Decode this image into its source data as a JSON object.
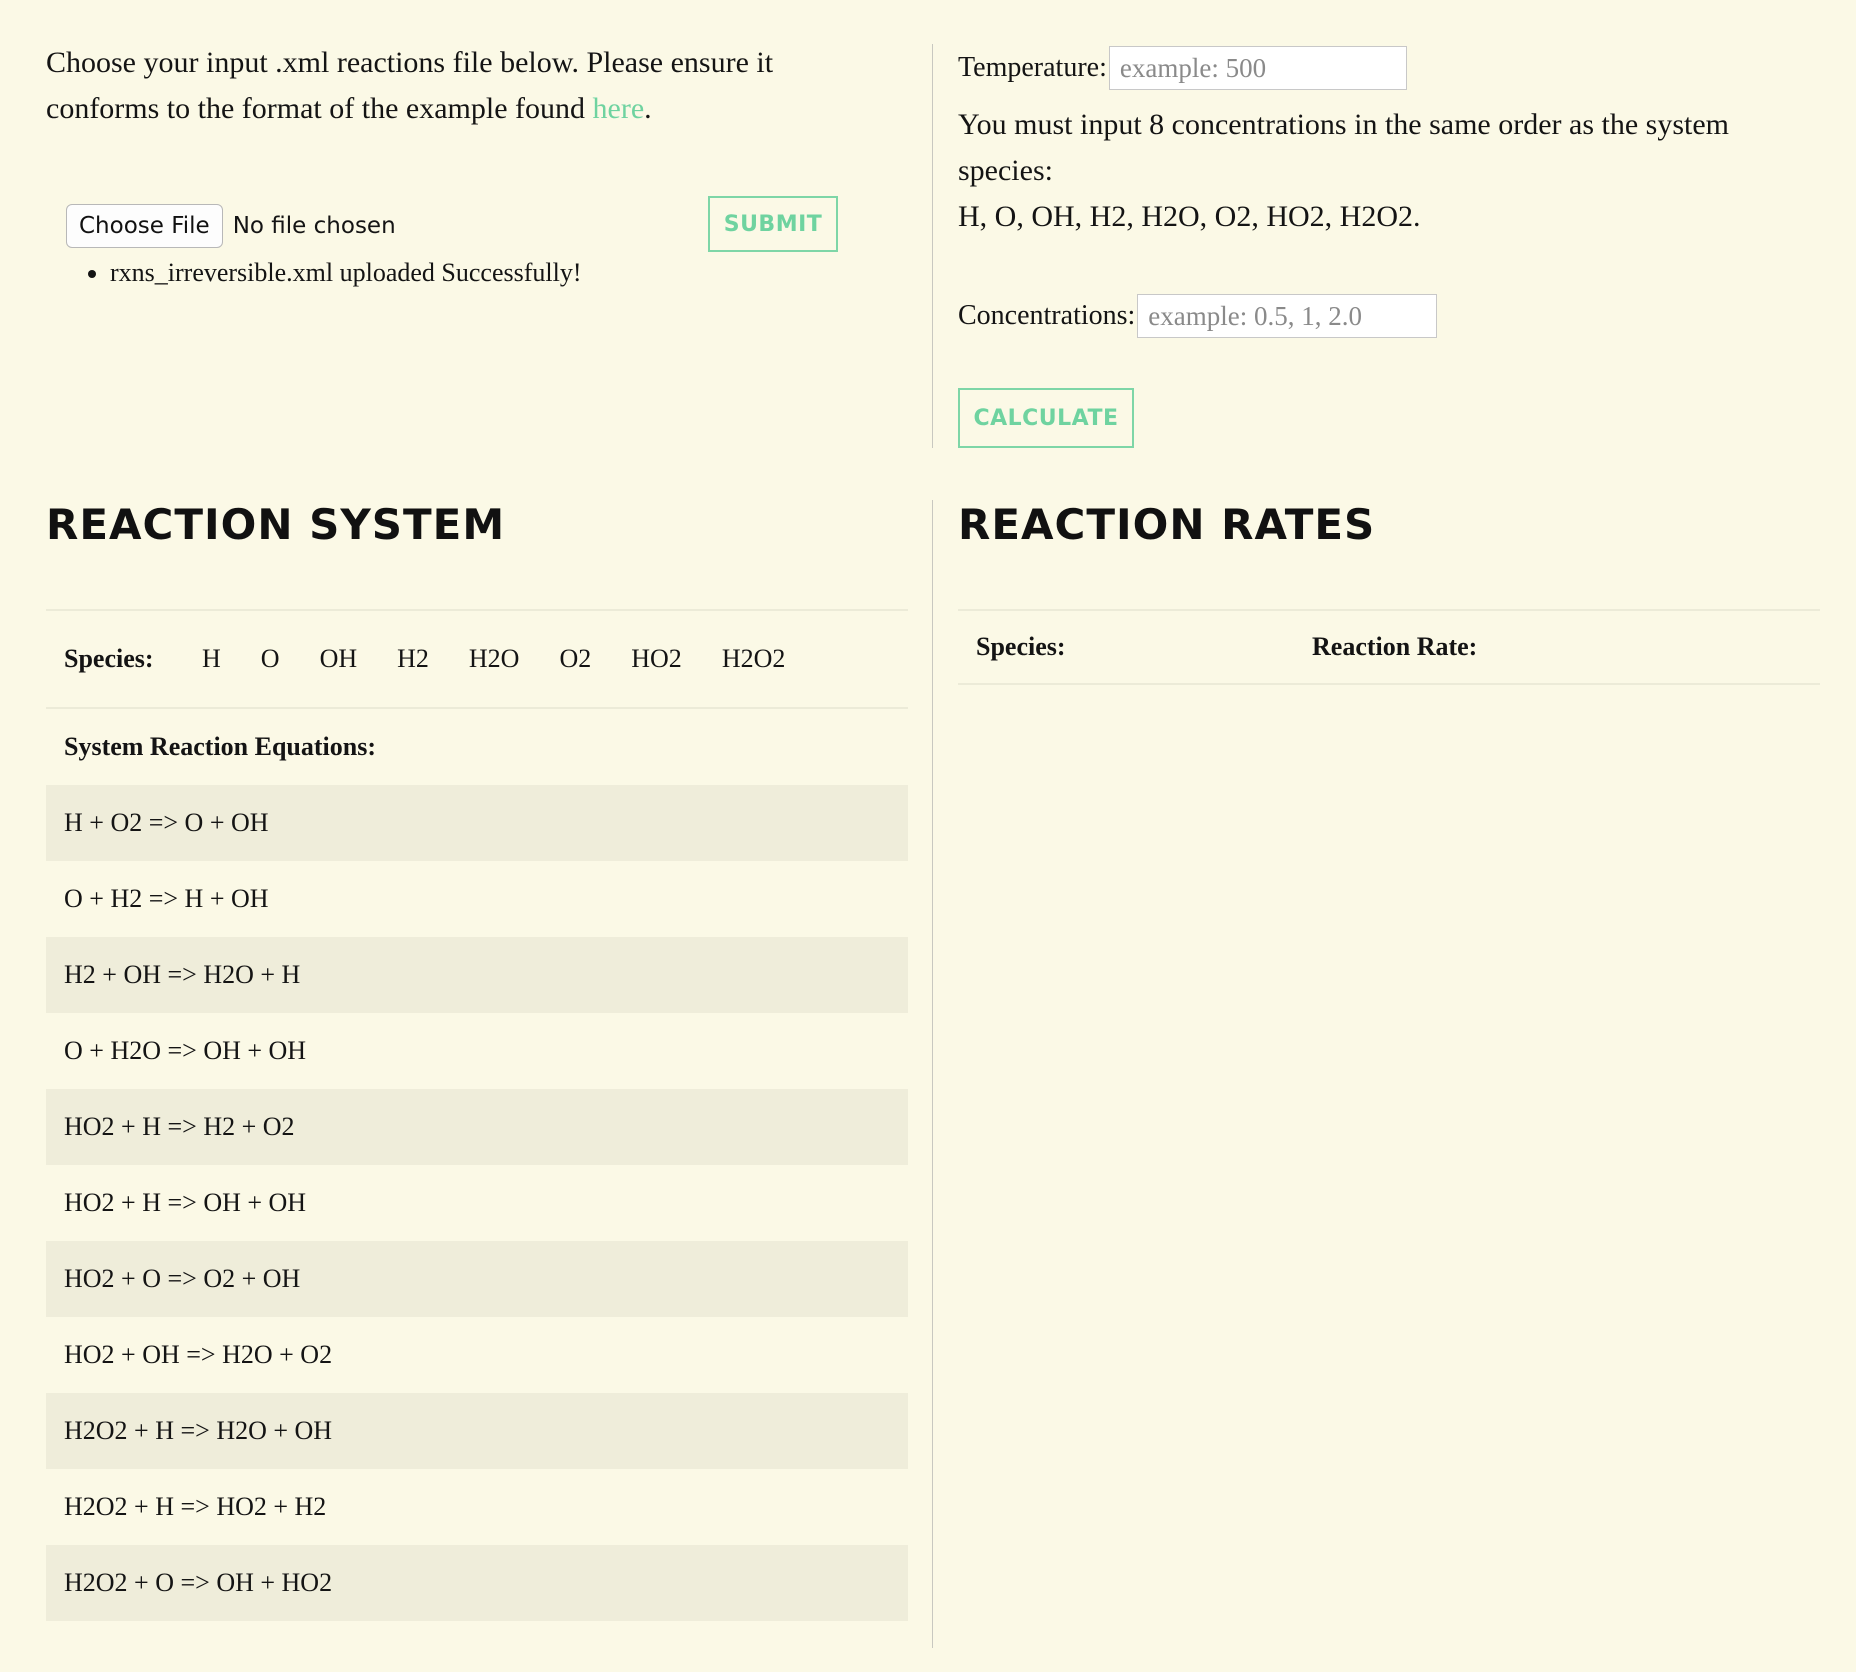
{
  "upload": {
    "intro_text": "Choose your input .xml reactions file below. Please ensure it conforms to the format of the example found ",
    "link_text": "here",
    "intro_end": ".",
    "choose_file_label": "Choose File",
    "no_file_text": "No file chosen",
    "submit_label": "SUBMIT",
    "messages": [
      "rxns_irreversible.xml uploaded Successfully!"
    ]
  },
  "calc": {
    "temperature_label": "Temperature:",
    "temperature_placeholder": "example: 500",
    "instruction": "You must input 8 concentrations in the same order as the system species:",
    "species_list": "H, O, OH, H2, H2O, O2, HO2, H2O2.",
    "concentrations_label": "Concentrations:",
    "concentrations_placeholder": "example: 0.5, 1, 2.0",
    "calculate_label": "CALCULATE"
  },
  "reaction_system": {
    "heading": "REACTION SYSTEM",
    "species_label": "Species:",
    "species": [
      "H",
      "O",
      "OH",
      "H2",
      "H2O",
      "O2",
      "HO2",
      "H2O2"
    ],
    "equations_label": "System Reaction Equations:",
    "equations": [
      "H + O2 => O + OH",
      "O + H2 => H + OH",
      "H2 + OH => H2O + H",
      "O + H2O => OH + OH",
      "HO2 + H => H2 + O2",
      "HO2 + H => OH + OH",
      "HO2 + O => O2 + OH",
      "HO2 + OH => H2O + O2",
      "H2O2 + H => H2O + OH",
      "H2O2 + H => HO2 + H2",
      "H2O2 + O => OH + HO2"
    ]
  },
  "reaction_rates": {
    "heading": "REACTION RATES",
    "species_label": "Species:",
    "rate_label": "Reaction Rate:"
  },
  "colors": {
    "background": "#fbf9e6",
    "accent": "#6fd3a0",
    "stripe": "#efedda"
  }
}
